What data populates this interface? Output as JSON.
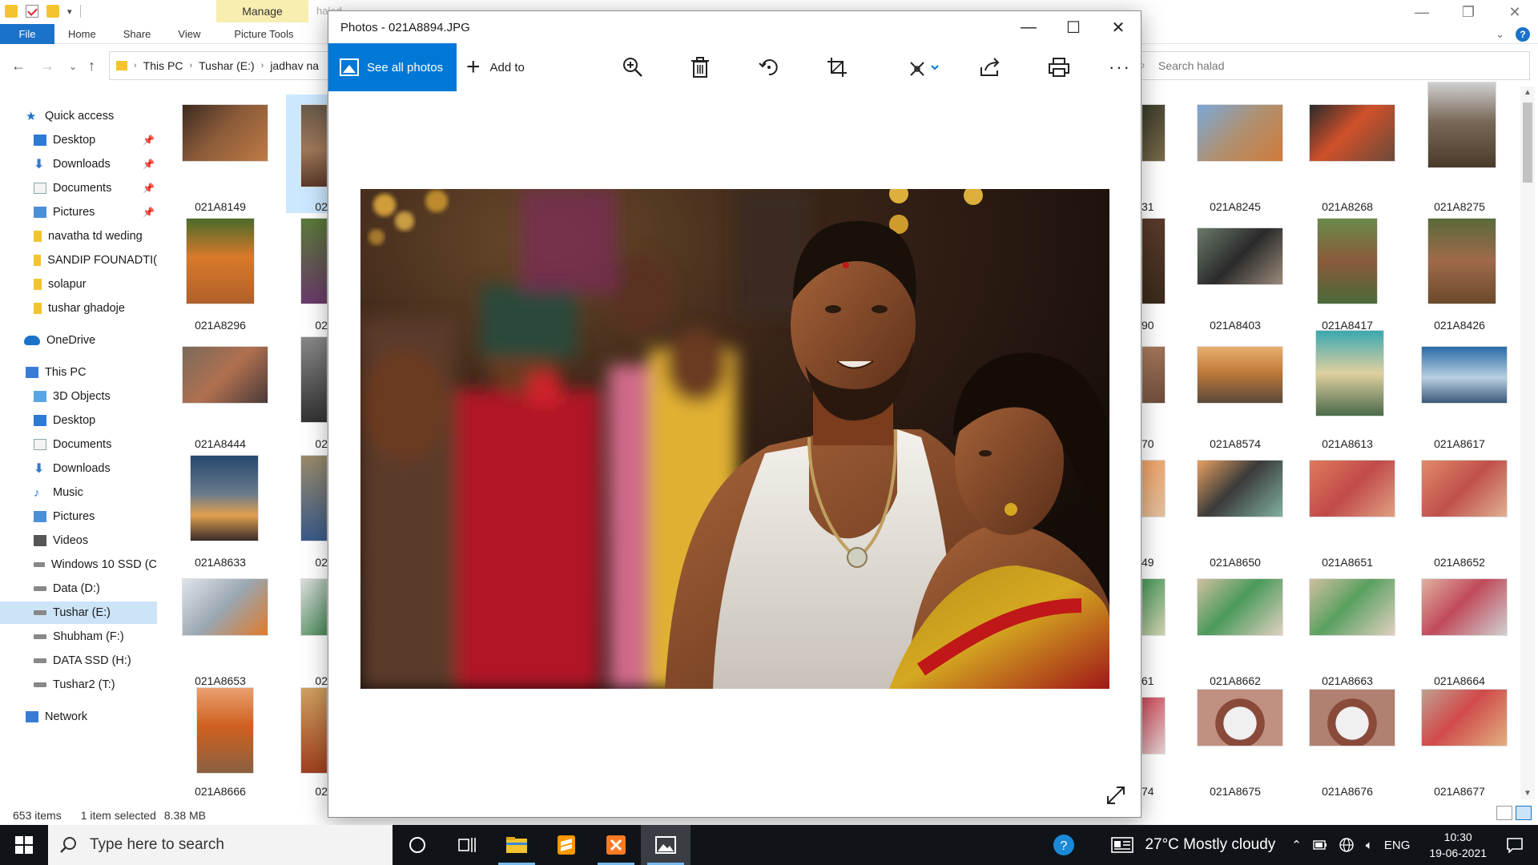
{
  "explorer": {
    "manage_tab": "Manage",
    "ghost_title": "halad",
    "ribbon_tabs": [
      "File",
      "Home",
      "Share",
      "View",
      "Picture Tools"
    ],
    "address": {
      "crumbs": [
        "This PC",
        "Tushar (E:)",
        "jadhav na"
      ]
    },
    "search": {
      "placeholder": "Search halad"
    },
    "nav": {
      "quick_access": "Quick access",
      "items": [
        {
          "label": "Desktop",
          "icon": "desktop-icon",
          "pinned": true
        },
        {
          "label": "Downloads",
          "icon": "download-icon",
          "pinned": true
        },
        {
          "label": "Documents",
          "icon": "document-icon",
          "pinned": true
        },
        {
          "label": "Pictures",
          "icon": "pictures-icon",
          "pinned": true
        },
        {
          "label": "navatha td weding",
          "icon": "folder-icon"
        },
        {
          "label": "SANDIP FOUNADTI(",
          "icon": "folder-icon"
        },
        {
          "label": "solapur",
          "icon": "folder-icon"
        },
        {
          "label": "tushar ghadoje",
          "icon": "folder-icon"
        }
      ],
      "onedrive": "OneDrive",
      "this_pc": "This PC",
      "pc_items": [
        {
          "label": "3D Objects",
          "icon": "3d-objects-icon"
        },
        {
          "label": "Desktop",
          "icon": "desktop-icon"
        },
        {
          "label": "Documents",
          "icon": "document-icon"
        },
        {
          "label": "Downloads",
          "icon": "download-icon"
        },
        {
          "label": "Music",
          "icon": "music-icon"
        },
        {
          "label": "Pictures",
          "icon": "pictures-icon"
        },
        {
          "label": "Videos",
          "icon": "videos-icon"
        },
        {
          "label": "Windows 10 SSD (C",
          "icon": "drive-icon"
        },
        {
          "label": "Data (D:)",
          "icon": "drive-icon"
        },
        {
          "label": "Tushar (E:)",
          "icon": "drive-icon",
          "selected": true
        },
        {
          "label": "Shubham (F:)",
          "icon": "drive-icon"
        },
        {
          "label": "DATA SSD (H:)",
          "icon": "drive-icon"
        },
        {
          "label": "Tushar2 (T:)",
          "icon": "drive-icon"
        }
      ],
      "network": "Network"
    },
    "thumbnails_left": [
      [
        "021A8149",
        "02"
      ],
      [
        "021A8296",
        "02"
      ],
      [
        "021A8444",
        "02"
      ],
      [
        "021A8633",
        "02"
      ],
      [
        "021A8653",
        "02"
      ],
      [
        "021A8666",
        "02"
      ]
    ],
    "thumbnails_right": [
      [
        "31",
        "021A8245",
        "021A8268",
        "021A8275"
      ],
      [
        "90",
        "021A8403",
        "021A8417",
        "021A8426"
      ],
      [
        "70",
        "021A8574",
        "021A8613",
        "021A8617"
      ],
      [
        "49",
        "021A8650",
        "021A8651",
        "021A8652"
      ],
      [
        "61",
        "021A8662",
        "021A8663",
        "021A8664"
      ],
      [
        "74",
        "021A8675",
        "021A8676",
        "021A8677"
      ]
    ],
    "status": {
      "items": "653 items",
      "selected": "1 item selected",
      "size": "8.38 MB"
    }
  },
  "photos": {
    "title": "Photos - 021A8894.JPG",
    "see_all": "See all photos",
    "add_to": "Add to",
    "tools": [
      "zoom-in-icon",
      "delete-icon",
      "rotate-icon",
      "crop-icon",
      "edit-icon",
      "share-icon",
      "print-icon",
      "more-icon"
    ],
    "accent": "#0078d7"
  },
  "taskbar": {
    "search_placeholder": "Type here to search",
    "weather": "27°C  Mostly cloudy",
    "lang": "ENG",
    "time": "10:30",
    "date": "19-06-2021"
  }
}
